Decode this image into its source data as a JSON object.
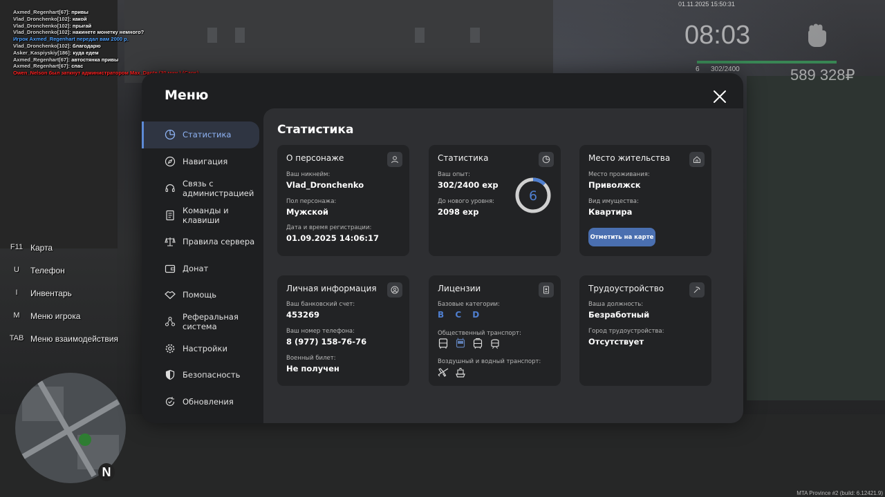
{
  "chat": [
    {
      "name": "Axmed_Regenhart[67]:",
      "msg": "привы",
      "type": "normal"
    },
    {
      "name": "Vlad_Dronchenko[102]:",
      "msg": "какой",
      "type": "normal"
    },
    {
      "name": "Vlad_Dronchenko[102]:",
      "msg": "прыгай",
      "type": "normal"
    },
    {
      "name": "Vlad_Dronchenko[102]:",
      "msg": "накинете монетку немного?",
      "type": "normal"
    },
    {
      "name": "",
      "msg": "Игрок Axmed_Regenhart передал вам 2000 р.",
      "type": "blue"
    },
    {
      "name": "Vlad_Dronchenko[102]:",
      "msg": "благодарю",
      "type": "normal"
    },
    {
      "name": "Asker_Kaspiyskiy[186]:",
      "msg": "куда едем",
      "type": "normal"
    },
    {
      "name": "Axmed_Regenhart[67]:",
      "msg": "автостянка привы",
      "type": "normal"
    },
    {
      "name": "Axmed_Regenhart[67]:",
      "msg": "спас",
      "type": "normal"
    },
    {
      "name": "",
      "msg": "Owen_Nelson был заткнут администратором Max_Dante (30 мин.) (Caps)",
      "type": "red"
    }
  ],
  "hud": {
    "date": "01.11.2025 15:50:31",
    "clock": "08:03",
    "level": "6",
    "exp": "302/2400",
    "money": "589 328₽"
  },
  "hotkeys": [
    {
      "key": "F11",
      "label": "Карта"
    },
    {
      "key": "U",
      "label": "Телефон"
    },
    {
      "key": "I",
      "label": "Инвентарь"
    },
    {
      "key": "M",
      "label": "Меню игрока"
    },
    {
      "key": "TAB",
      "label": "Меню взаимодействия"
    }
  ],
  "build": "MTA Province #2 (build: 6.12421.9)",
  "menu": {
    "title": "Меню",
    "sidebar": [
      {
        "label": "Статистика",
        "icon": "pie-chart-icon",
        "active": true
      },
      {
        "label": "Навигация",
        "icon": "compass-icon"
      },
      {
        "label": "Связь с администрацией",
        "icon": "headset-icon"
      },
      {
        "label": "Команды и клавиши",
        "icon": "document-icon"
      },
      {
        "label": "Правила сервера",
        "icon": "scales-icon"
      },
      {
        "label": "Донат",
        "icon": "wallet-icon"
      },
      {
        "label": "Помощь",
        "icon": "handshake-icon"
      },
      {
        "label": "Реферальная система",
        "icon": "network-icon"
      },
      {
        "label": "Настройки",
        "icon": "gear-icon"
      },
      {
        "label": "Безопасность",
        "icon": "shield-icon"
      },
      {
        "label": "Обновления",
        "icon": "refresh-icon"
      }
    ],
    "content_title": "Статистика",
    "cards": {
      "person": {
        "title": "О персонаже",
        "nick_label": "Ваш никнейм:",
        "nick": "Vlad_Dronchenko",
        "gender_label": "Пол персонажа:",
        "gender": "Мужской",
        "reg_label": "Дата и время регистрации:",
        "reg": "01.09.2025 14:06:17"
      },
      "stats": {
        "title": "Статистика",
        "exp_label": "Ваш опыт:",
        "exp": "302/2400 exp",
        "next_label": "До нового уровня:",
        "next": "2098 exp",
        "level": "6",
        "level_progress": 0.126
      },
      "home": {
        "title": "Место жительства",
        "place_label": "Место проживания:",
        "place": "Приволжск",
        "prop_label": "Вид имущества:",
        "prop": "Квартира",
        "button": "Отметить на карте"
      },
      "personal": {
        "title": "Личная информация",
        "bank_label": "Ваш банковский счет:",
        "bank": "453269",
        "phone_label": "Ваш номер телефона:",
        "phone": "8 (977) 158-76-76",
        "military_label": "Военный билет:",
        "military": "Не получен"
      },
      "licenses": {
        "title": "Лицензии",
        "base_label": "Базовые категории:",
        "base": "B C D",
        "public_label": "Общественный транспорт:",
        "air_label": "Воздушный и водный транспорт:"
      },
      "job": {
        "title": "Трудоустройство",
        "pos_label": "Ваша должность:",
        "pos": "Безработный",
        "city_label": "Город трудоустройства:",
        "city": "Отсутствует"
      }
    }
  }
}
